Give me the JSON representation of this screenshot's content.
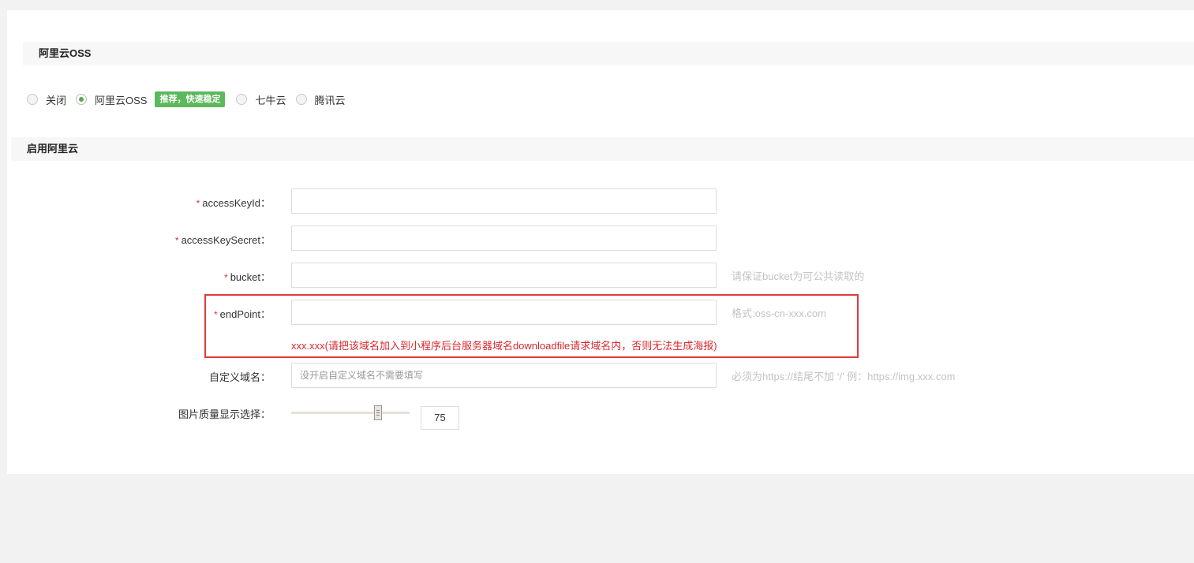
{
  "section_storage": {
    "title": "阿里云OSS"
  },
  "storage_options": [
    {
      "label": "关闭",
      "checked": false
    },
    {
      "label": "阿里云OSS",
      "checked": true
    },
    {
      "label": "七牛云",
      "checked": false
    },
    {
      "label": "腾讯云",
      "checked": false
    }
  ],
  "recommend_badge": "推荐，快速稳定",
  "section_enable": {
    "title": "启用阿里云"
  },
  "form": {
    "required_mark": "*",
    "access_key_id": {
      "label": "accessKeyId：",
      "value": ""
    },
    "access_key_secret": {
      "label": "accessKeySecret：",
      "value": ""
    },
    "bucket": {
      "label": "bucket：",
      "value": "",
      "hint": "请保证bucket为可公共读取的"
    },
    "endpoint": {
      "label": "endPoint：",
      "value": "",
      "hint": "格式:oss-cn-xxx.com",
      "note": "xxx.xxx(请把该域名加入到小程序后台服务器域名downloadfile请求域名内，否则无法生成海报)"
    },
    "custom_domain": {
      "label": "自定义域名：",
      "value": "",
      "placeholder": "没开启自定义域名不需要填写",
      "hint": "必须为https://结尾不加 ‘/’ 例：https://img.xxx.com"
    },
    "image_quality": {
      "label": "图片质量显示选择：",
      "value": "75",
      "fraction": 0.73
    }
  },
  "colors": {
    "accent": "#4caf50",
    "badge": "#5cb85c",
    "error": "#d9282e",
    "highlight": "#e0393e"
  }
}
